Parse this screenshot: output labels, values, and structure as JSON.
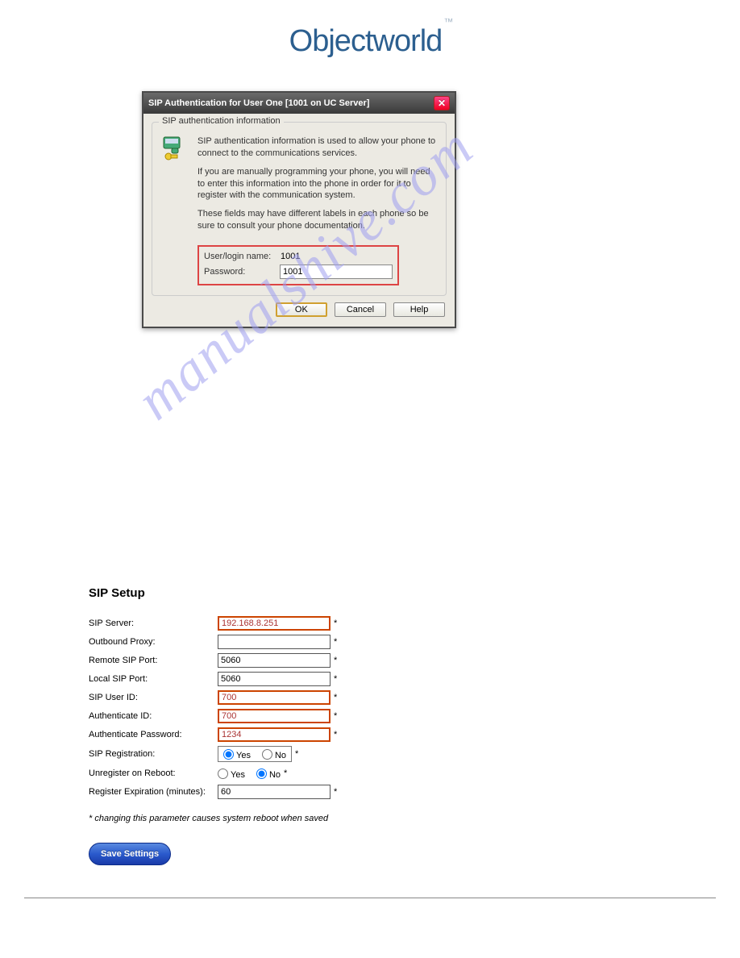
{
  "logo": {
    "text": "Objectworld",
    "tm": "™"
  },
  "dialog": {
    "title": "SIP Authentication for User One [1001 on UC Server]",
    "group_legend": "SIP authentication information",
    "p1": "SIP authentication information is used to allow your phone to connect to the communications services.",
    "p2": "If you are manually programming your phone, you will need to enter this information into the phone in order for it to register with the communication system.",
    "p3": "These fields may have different labels in each phone so be sure to consult your phone documentation.",
    "user_label": "User/login name:",
    "user_value": "1001",
    "pass_label": "Password:",
    "pass_value": "1001",
    "ok": "OK",
    "cancel": "Cancel",
    "help": "Help"
  },
  "watermark": "manualshive.com",
  "sip": {
    "title": "SIP Setup",
    "rows": {
      "server_label": "SIP Server:",
      "server_value": "192.168.8.251",
      "proxy_label": "Outbound Proxy:",
      "proxy_value": "",
      "rport_label": "Remote SIP Port:",
      "rport_value": "5060",
      "lport_label": "Local SIP Port:",
      "lport_value": "5060",
      "uid_label": "SIP User ID:",
      "uid_value": "700",
      "authid_label": "Authenticate ID:",
      "authid_value": "700",
      "authpw_label": "Authenticate Password:",
      "authpw_value": "1234",
      "reg_label": "SIP Registration:",
      "unreg_label": "Unregister on Reboot:",
      "exp_label": "Register Expiration (minutes):",
      "exp_value": "60",
      "yes": "Yes",
      "no": "No"
    },
    "footnote": "* changing this parameter causes system reboot when saved",
    "save": "Save Settings",
    "star": "*"
  }
}
